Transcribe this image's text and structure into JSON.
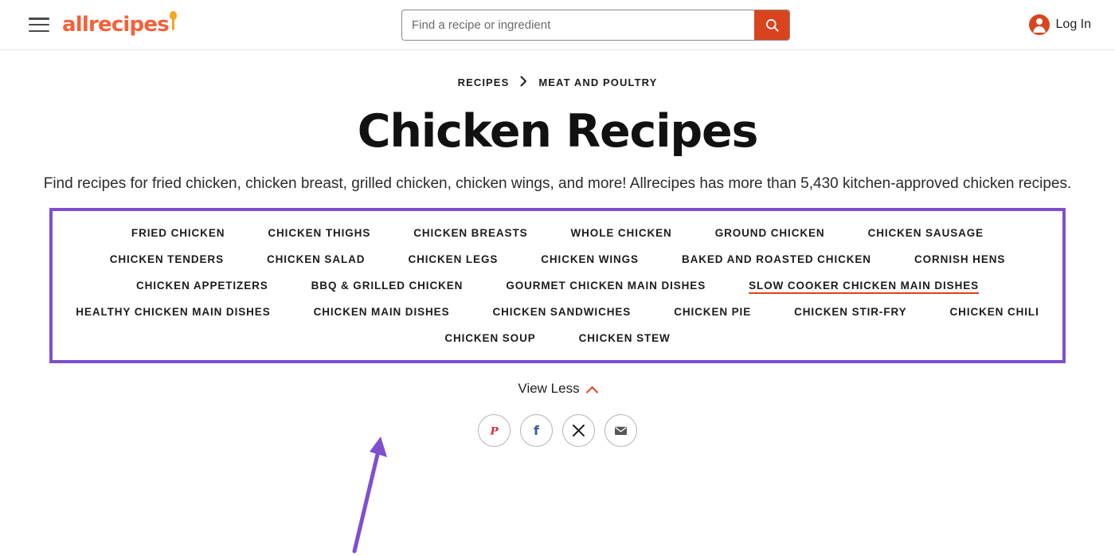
{
  "header": {
    "menu_icon": "hamburger-icon",
    "logo_text": "allrecipes",
    "logo_icon": "spoon-icon",
    "search": {
      "placeholder": "Find a recipe or ingredient",
      "value": "",
      "button_icon": "search-icon"
    },
    "account": {
      "label": "Log In",
      "icon": "user-avatar-icon"
    }
  },
  "breadcrumb": {
    "items": [
      {
        "label": "RECIPES"
      },
      {
        "label": "MEAT AND POULTRY"
      }
    ],
    "separator": "›"
  },
  "page": {
    "title": "Chicken Recipes",
    "description": "Find recipes for fried chicken, chicken breast, grilled chicken, chicken wings, and more! Allrecipes has more than 5,430 kitchen-approved chicken recipes."
  },
  "categories": {
    "highlight_color": "#7f4fce",
    "active_underline_color": "#d9441f",
    "rows": [
      [
        {
          "label": "FRIED CHICKEN",
          "active": false
        },
        {
          "label": "CHICKEN THIGHS",
          "active": false
        },
        {
          "label": "CHICKEN BREASTS",
          "active": false
        },
        {
          "label": "WHOLE CHICKEN",
          "active": false
        },
        {
          "label": "GROUND CHICKEN",
          "active": false
        },
        {
          "label": "CHICKEN SAUSAGE",
          "active": false
        }
      ],
      [
        {
          "label": "CHICKEN TENDERS",
          "active": false
        },
        {
          "label": "CHICKEN SALAD",
          "active": false
        },
        {
          "label": "CHICKEN LEGS",
          "active": false
        },
        {
          "label": "CHICKEN WINGS",
          "active": false
        },
        {
          "label": "BAKED AND ROASTED CHICKEN",
          "active": false
        },
        {
          "label": "CORNISH HENS",
          "active": false
        }
      ],
      [
        {
          "label": "CHICKEN APPETIZERS",
          "active": false
        },
        {
          "label": "BBQ & GRILLED CHICKEN",
          "active": false
        },
        {
          "label": "GOURMET CHICKEN MAIN DISHES",
          "active": false
        },
        {
          "label": "SLOW COOKER CHICKEN MAIN DISHES",
          "active": true
        }
      ],
      [
        {
          "label": "HEALTHY CHICKEN MAIN DISHES",
          "active": false
        },
        {
          "label": "CHICKEN MAIN DISHES",
          "active": false
        },
        {
          "label": "CHICKEN SANDWICHES",
          "active": false
        },
        {
          "label": "CHICKEN PIE",
          "active": false
        },
        {
          "label": "CHICKEN STIR-FRY",
          "active": false
        },
        {
          "label": "CHICKEN CHILI",
          "active": false
        }
      ],
      [
        {
          "label": "CHICKEN SOUP",
          "active": false
        },
        {
          "label": "CHICKEN STEW",
          "active": false
        }
      ]
    ]
  },
  "view_toggle": {
    "label": "View Less",
    "icon": "chevron-up-icon"
  },
  "social": {
    "items": [
      {
        "name": "pinterest-icon",
        "color": "#d32d3b"
      },
      {
        "name": "facebook-icon",
        "color": "#3b5998"
      },
      {
        "name": "x-twitter-icon",
        "color": "#111111"
      },
      {
        "name": "email-icon",
        "color": "#555555"
      }
    ]
  },
  "annotation": {
    "arrow_color": "#7f4fce"
  }
}
